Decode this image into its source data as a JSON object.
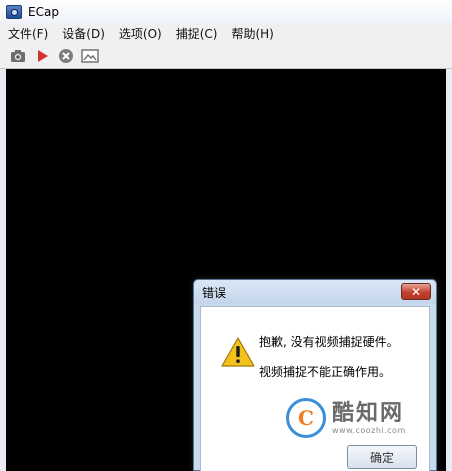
{
  "window": {
    "title": "ECap",
    "menu": [
      "文件(F)",
      "设备(D)",
      "选项(O)",
      "捕捉(C)",
      "帮助(H)"
    ],
    "toolbar": [
      {
        "icon": "camera-icon"
      },
      {
        "icon": "play-icon"
      },
      {
        "icon": "stop-icon"
      },
      {
        "icon": "image-icon"
      }
    ]
  },
  "dialog": {
    "title": "错误",
    "close_label": "✕",
    "message_line1": "抱歉, 没有视频捕捉硬件。",
    "message_line2": "视频捕捉不能正确作用。",
    "ok_label": "确定",
    "icon": "warning-icon"
  },
  "watermark": {
    "logo_letter": "C",
    "title": "酷知网",
    "url": "www.coozhi.com"
  },
  "colors": {
    "video_bg": "#000000",
    "close_button": "#c4412f",
    "warning_yellow": "#f2c21b",
    "watermark_blue": "#3b8ed8",
    "watermark_orange": "#f07b1e"
  }
}
